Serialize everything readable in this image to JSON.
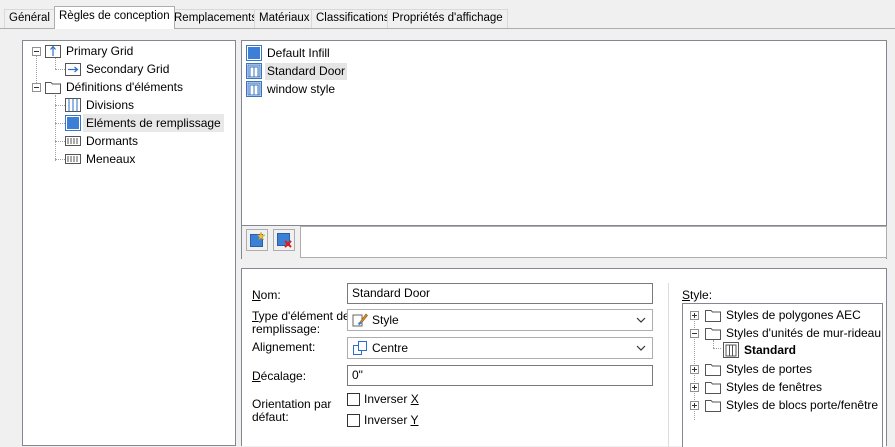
{
  "tabs": [
    {
      "label": "Général"
    },
    {
      "label": "Règles de conception"
    },
    {
      "label": "Remplacements"
    },
    {
      "label": "Matériaux"
    },
    {
      "label": "Classifications"
    },
    {
      "label": "Propriétés d'affichage"
    }
  ],
  "active_tab": "Règles de conception",
  "tree": {
    "primary_grid": "Primary Grid",
    "secondary_grid": "Secondary Grid",
    "definitions": "Définitions d'éléments",
    "divisions": "Divisions",
    "infill": "Eléments de remplissage",
    "frames": "Dormants",
    "mullions": "Meneaux"
  },
  "infill_list": [
    {
      "label": "Default Infill",
      "icon": "infill-icon"
    },
    {
      "label": "Standard Door",
      "icon": "door-style-icon"
    },
    {
      "label": "window style",
      "icon": "door-style-icon"
    }
  ],
  "selected_infill": "Standard Door",
  "toolbar": {
    "new_icon": "new-infill-icon",
    "delete_icon": "delete-infill-icon"
  },
  "form": {
    "name_label_u": "N",
    "name_label_rest": "om:",
    "name_value": "Standard Door",
    "type_label_u": "T",
    "type_label_rest1": "ype d'élément de",
    "type_label_rest2": "remplissage:",
    "type_value": "Style",
    "align_label_pre": "Ali",
    "align_label_u": "g",
    "align_label_rest": "nement:",
    "align_value": "Centre",
    "offset_label_u": "D",
    "offset_label_rest": "écalage:",
    "offset_value": "0\"",
    "orient_label1": "Orientation par",
    "orient_label2": "défaut:",
    "flip_x_pre": "Inverser ",
    "flip_x_u": "X",
    "flip_y_pre": "Inverser ",
    "flip_y_u": "Y",
    "flip_x_checked": false,
    "flip_y_checked": false
  },
  "style_tree": {
    "label_u": "S",
    "label_rest": "tyle:",
    "items": {
      "polygons": "Styles de polygones AEC",
      "curtain_units": "Styles d'unités de mur-rideau",
      "standard": "Standard",
      "doors": "Styles de portes",
      "windows": "Styles de fenêtres",
      "door_window": "Styles de blocs porte/fenêtre"
    }
  },
  "colors": {
    "accent_blue": "#2a6fc9",
    "selection": "#e5e5e5"
  }
}
